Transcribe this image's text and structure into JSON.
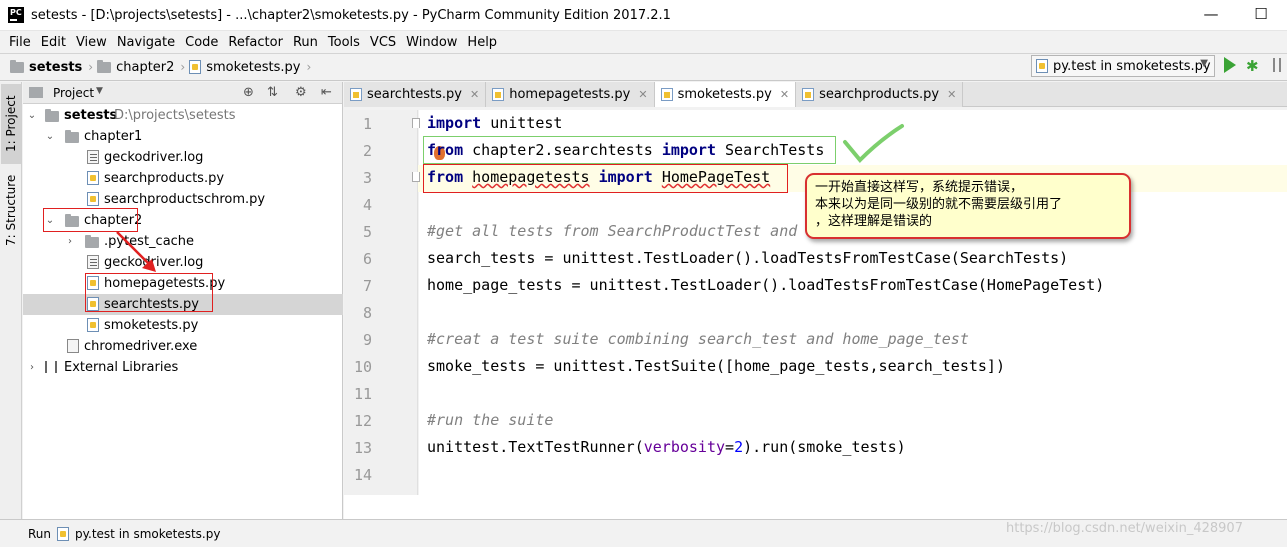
{
  "window": {
    "title": "setests - [D:\\projects\\setests] - ...\\chapter2\\smoketests.py - PyCharm Community Edition 2017.2.1",
    "logo_text": "PC"
  },
  "menu": [
    "File",
    "Edit",
    "View",
    "Navigate",
    "Code",
    "Refactor",
    "Run",
    "Tools",
    "VCS",
    "Window",
    "Help"
  ],
  "breadcrumb": [
    "setests",
    "chapter2",
    "smoketests.py"
  ],
  "run_config": "py.test in smoketests.py",
  "side_tabs": {
    "project": "1: Project",
    "structure": "7: Structure"
  },
  "project_panel": {
    "header": "Project",
    "tree": [
      {
        "label": "setests",
        "path": "D:\\projects\\setests",
        "type": "root"
      },
      {
        "label": "chapter1",
        "type": "folder"
      },
      {
        "label": "geckodriver.log",
        "type": "file"
      },
      {
        "label": "searchproducts.py",
        "type": "py"
      },
      {
        "label": "searchproductschrom.py",
        "type": "py"
      },
      {
        "label": "chapter2",
        "type": "folder"
      },
      {
        "label": ".pytest_cache",
        "type": "folder"
      },
      {
        "label": "geckodriver.log",
        "type": "file"
      },
      {
        "label": "homepagetests.py",
        "type": "py"
      },
      {
        "label": "searchtests.py",
        "type": "py"
      },
      {
        "label": "smoketests.py",
        "type": "py"
      },
      {
        "label": "chromedriver.exe",
        "type": "file"
      },
      {
        "label": "External Libraries",
        "type": "lib"
      }
    ]
  },
  "editor_tabs": [
    "searchtests.py",
    "homepagetests.py",
    "smoketests.py",
    "searchproducts.py"
  ],
  "active_tab": "smoketests.py",
  "code_lines": [
    "import unittest",
    "from chapter2.searchtests import SearchTests",
    "from homepagetests import HomePageTest",
    "",
    "#get all tests from SearchProductTest and",
    "search_tests = unittest.TestLoader().loadTestsFromTestCase(SearchTests)",
    "home_page_tests = unittest.TestLoader().loadTestsFromTestCase(HomePageTest)",
    "",
    "#creat a test suite combining search_test and home_page_test",
    "smoke_tests = unittest.TestSuite([home_page_tests,search_tests])",
    "",
    "#run the suite",
    "unittest.TextTestRunner(verbosity=2).run(smoke_tests)",
    ""
  ],
  "line_numbers": [
    "1",
    "2",
    "3",
    "4",
    "5",
    "6",
    "7",
    "8",
    "9",
    "10",
    "11",
    "12",
    "13",
    "14"
  ],
  "annotation": {
    "line1": "一开始直接这样写，系统提示错误，",
    "line2": "本来以为是同一级别的就不需要层级引用了",
    "line3": "，这样理解是错误的"
  },
  "status": {
    "run_label": "Run",
    "run_config": "py.test in smoketests.py"
  },
  "watermark": "https://blog.csdn.net/weixin_428907",
  "colors": {
    "keyword": "#000080",
    "comment": "#808080",
    "highlight": "#e02020",
    "check": "#7ccf6c"
  }
}
